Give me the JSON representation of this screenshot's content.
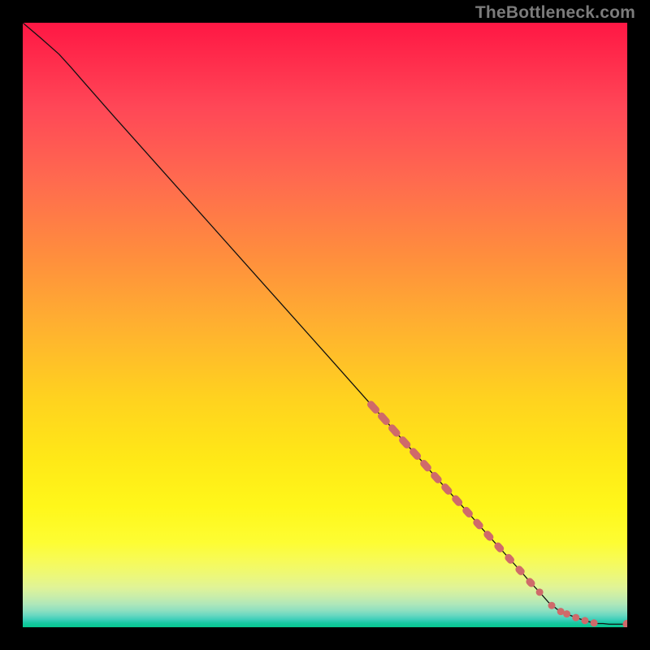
{
  "watermark": "TheBottleneck.com",
  "chart_data": {
    "type": "line",
    "title": "",
    "xlabel": "",
    "ylabel": "",
    "xlim": [
      0,
      100
    ],
    "ylim": [
      0,
      100
    ],
    "series": [
      {
        "name": "curve",
        "x": [
          0,
          2,
          4,
          6,
          8,
          10,
          15,
          20,
          30,
          40,
          50,
          58,
          60,
          63,
          66,
          68,
          70,
          72,
          74,
          76,
          78,
          80,
          82,
          84,
          85.5,
          87,
          88.5,
          90,
          91.5,
          93,
          94.5,
          95,
          96,
          97,
          100
        ],
        "y": [
          100,
          98.5,
          96.8,
          94.8,
          92.6,
          90.3,
          84.6,
          79.0,
          67.8,
          56.6,
          45.4,
          36.4,
          34.2,
          30.8,
          27.5,
          25.2,
          23.0,
          20.8,
          18.6,
          16.3,
          14.1,
          11.9,
          9.7,
          7.4,
          5.8,
          4.1,
          2.9,
          2.2,
          1.6,
          1.1,
          0.7,
          0.6,
          0.6,
          0.5,
          0.5
        ]
      }
    ],
    "markers_dense": {
      "x_start": 58,
      "x_end": 84,
      "count": 16
    },
    "markers_sparse": [
      {
        "x": 85.5,
        "y": 5.8
      },
      {
        "x": 87.5,
        "y": 3.6
      },
      {
        "x": 89.0,
        "y": 2.6
      },
      {
        "x": 90.0,
        "y": 2.2
      },
      {
        "x": 91.5,
        "y": 1.6
      },
      {
        "x": 93.0,
        "y": 1.1
      },
      {
        "x": 94.5,
        "y": 0.7
      },
      {
        "x": 100.0,
        "y": 0.5
      }
    ]
  }
}
